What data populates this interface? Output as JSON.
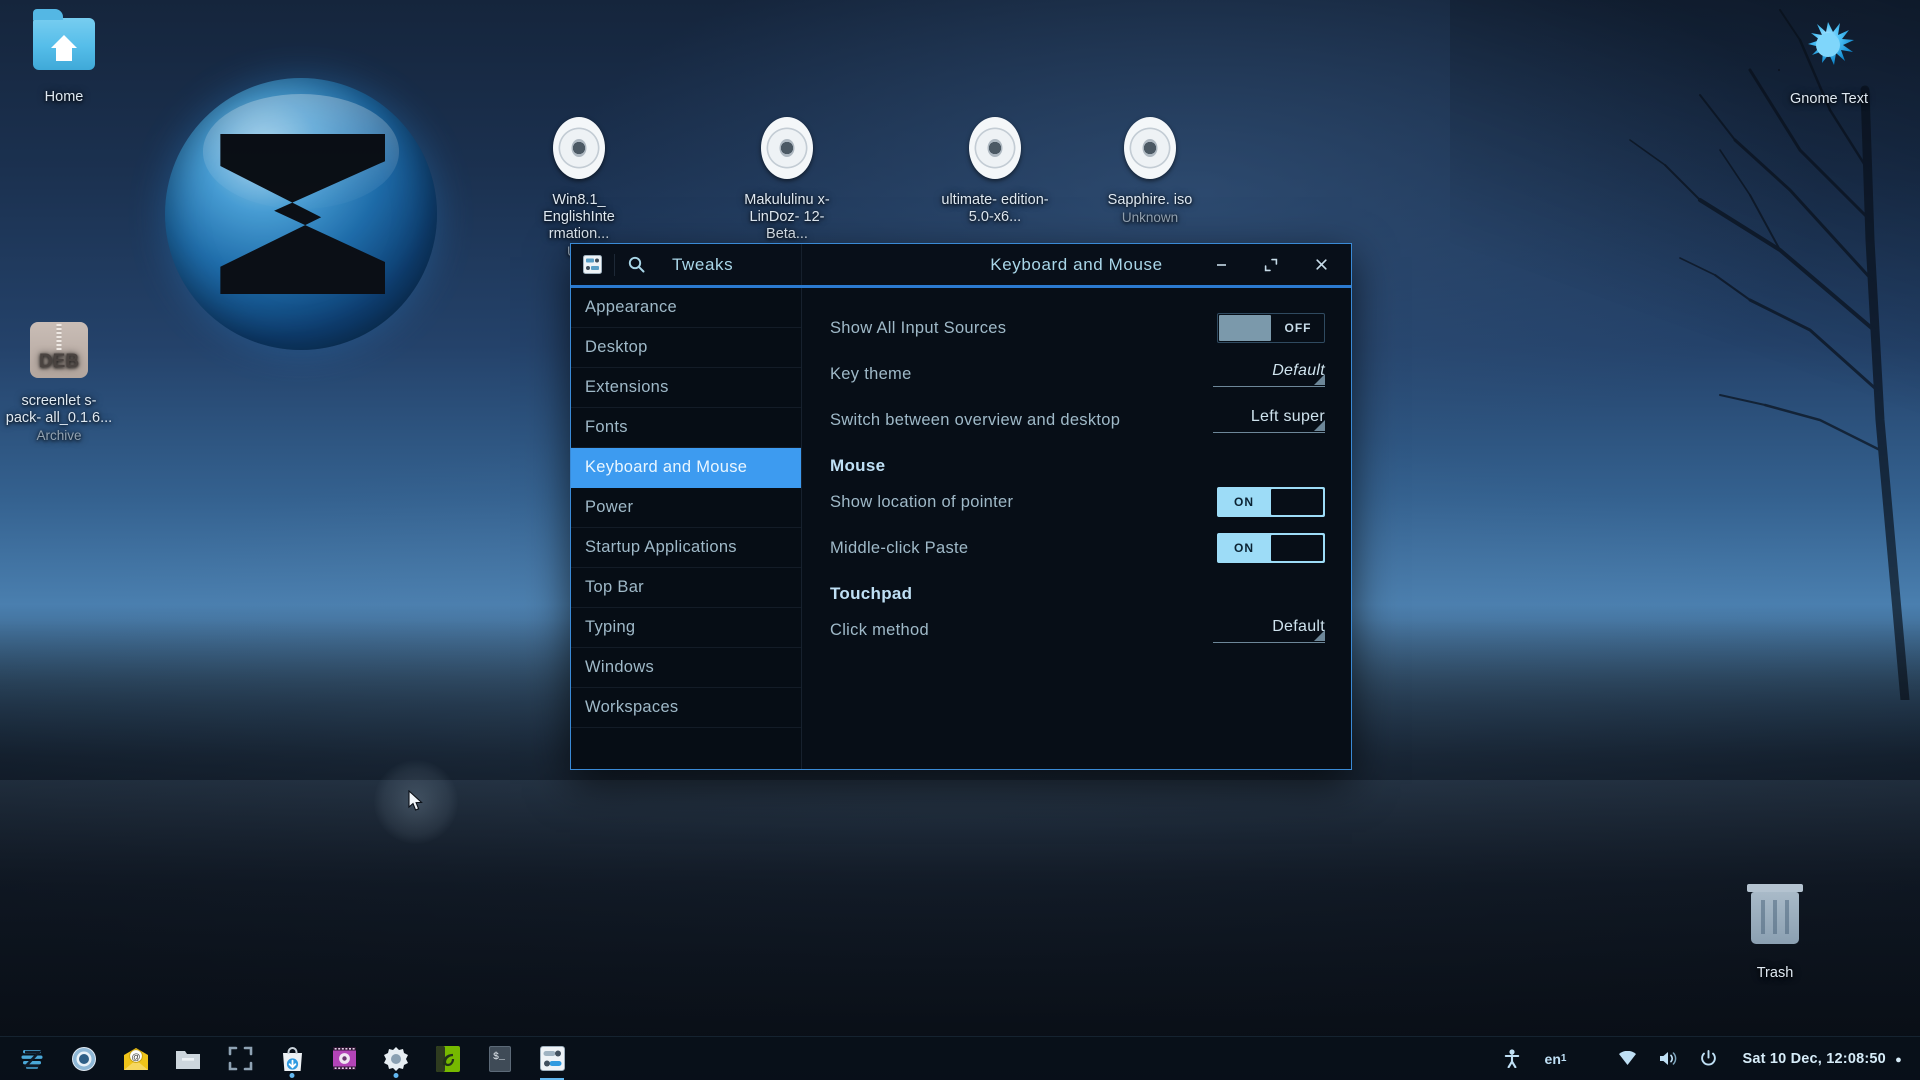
{
  "desktop": {
    "icons": [
      {
        "name": "Home",
        "sub": "",
        "type": "folder"
      },
      {
        "name": "screenlets-pack-all_0.1.6...",
        "sub": "Archive",
        "type": "deb"
      },
      {
        "name": "Win8.1_EnglishInternation...",
        "sub": "Unknown",
        "type": "disc"
      },
      {
        "name": "Makululinux-LinDoz-12-Beta...",
        "sub": "",
        "type": "disc"
      },
      {
        "name": "ultimate-edition-5.0-x6...",
        "sub": "",
        "type": "disc"
      },
      {
        "name": "Sapphire.iso",
        "sub": "Unknown",
        "type": "disc"
      },
      {
        "name": "Gnome Text",
        "sub": "",
        "type": "splash"
      },
      {
        "name": "Trash",
        "sub": "",
        "type": "trash"
      }
    ],
    "icon_labels": {
      "home": "Home",
      "screenlets_l1": "screenlet",
      "screenlets_l2": "s-pack-",
      "screenlets_l3": "all_0.1.6...",
      "screenlets_sub": "Archive",
      "iso1_l1": "Win8.1_",
      "iso1_l2": "EnglishInte",
      "iso1_l3": "rmation...",
      "iso1_sub": "Unk",
      "iso2_l1": "Makululinu",
      "iso2_l2": "x-LinDoz-",
      "iso2_l3": "12-Beta...",
      "iso3_l1": "ultimate-",
      "iso3_l2": "edition-",
      "iso3_l3": "5.0-x6...",
      "iso4_l1": "Sapphire.",
      "iso4_l2": "iso",
      "iso4_sub": "Unknown",
      "gnome_l1": "Gnome",
      "gnome_l2": "Text",
      "trash": "Trash"
    }
  },
  "window": {
    "app_name": "Tweaks",
    "title": "Keyboard and Mouse",
    "header_icon": "tweaks-icon",
    "search_icon": "search-icon",
    "minimize_label": "–",
    "maximize_label": "⤡",
    "close_label": "×",
    "accent": "#2b7ad0",
    "selected_color": "#3d9bf0"
  },
  "sidebar": {
    "items": [
      {
        "label": "Appearance",
        "selected": false
      },
      {
        "label": "Desktop",
        "selected": false
      },
      {
        "label": "Extensions",
        "selected": false
      },
      {
        "label": "Fonts",
        "selected": false
      },
      {
        "label": "Keyboard and Mouse",
        "selected": true
      },
      {
        "label": "Power",
        "selected": false
      },
      {
        "label": "Startup Applications",
        "selected": false
      },
      {
        "label": "Top Bar",
        "selected": false
      },
      {
        "label": "Typing",
        "selected": false
      },
      {
        "label": "Windows",
        "selected": false
      },
      {
        "label": "Workspaces",
        "selected": false
      }
    ]
  },
  "content": {
    "rows": [
      {
        "label": "Show All Input Sources",
        "control": "toggle",
        "value": "OFF",
        "state": "off"
      },
      {
        "label": "Key theme",
        "control": "dropdown",
        "value": "Default",
        "italic": true
      },
      {
        "label": "Switch between overview and desktop",
        "control": "dropdown",
        "value": "Left super",
        "italic": false
      }
    ],
    "mouse_heading": "Mouse",
    "mouse_rows": [
      {
        "label": "Show location of pointer",
        "control": "toggle",
        "value": "ON",
        "state": "on"
      },
      {
        "label": "Middle-click Paste",
        "control": "toggle",
        "value": "ON",
        "state": "on"
      }
    ],
    "touchpad_heading": "Touchpad",
    "touchpad_rows": [
      {
        "label": "Click method",
        "control": "dropdown",
        "value": "Default",
        "italic": false
      }
    ]
  },
  "taskbar": {
    "items": [
      {
        "name": "zorin-menu-icon",
        "running": false
      },
      {
        "name": "chromium-browser-icon",
        "running": false
      },
      {
        "name": "mail-client-icon",
        "running": false
      },
      {
        "name": "file-manager-icon",
        "running": false
      },
      {
        "name": "screenshot-tool-icon",
        "running": false
      },
      {
        "name": "software-store-icon",
        "running": true
      },
      {
        "name": "media-player-icon",
        "running": false
      },
      {
        "name": "settings-icon",
        "running": true
      },
      {
        "name": "nvidia-settings-icon",
        "running": false
      },
      {
        "name": "terminal-icon",
        "running": false
      },
      {
        "name": "tweaks-icon",
        "running": true
      }
    ],
    "tray": {
      "accessibility_icon": "accessibility-icon",
      "keyboard_layout": "en",
      "keyboard_layout_sub": "1",
      "network_icon": "wifi-icon",
      "volume_icon": "volume-icon",
      "power_icon": "power-icon",
      "clock": "Sat 10 Dec, 12:08:50",
      "clock_dot": "●"
    }
  }
}
